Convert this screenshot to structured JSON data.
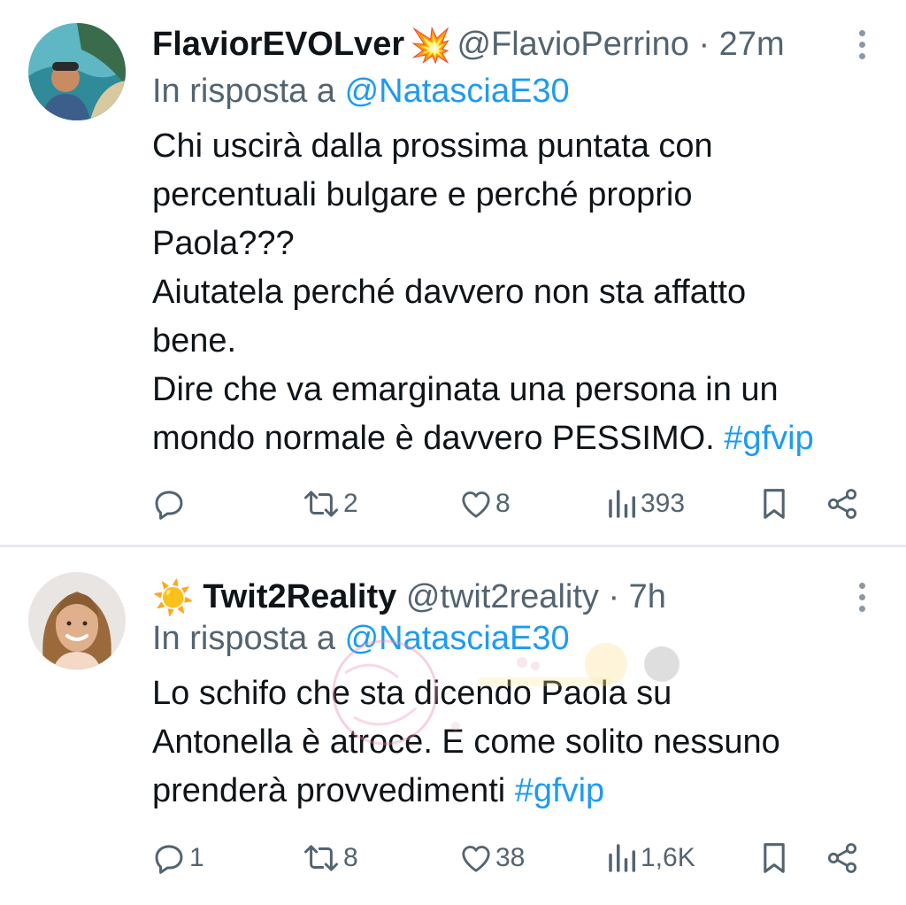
{
  "tweets": [
    {
      "display_name": "FlaviorEVOLver",
      "name_emoji": "💥",
      "handle": "@FlavioPerrino",
      "separator": "·",
      "time": "27m",
      "reply_prefix": "In risposta a",
      "reply_to": "@NatasciaE30",
      "body": "Chi uscirà dalla prossima puntata con\npercentuali bulgare e perché proprio\nPaola???\nAiutatela perché davvero non sta affatto\nbene.\nDire che va emarginata una persona in un\nmondo normale è davvero PESSIMO. ",
      "hashtag": "#gfvip",
      "replies": "",
      "retweets": "2",
      "likes": "8",
      "views": "393"
    },
    {
      "name_emoji": "☀️",
      "display_name": "Twit2Reality",
      "handle": "@twit2reality",
      "separator": "·",
      "time": "7h",
      "reply_prefix": "In risposta a",
      "reply_to": "@NatasciaE30",
      "body": "Lo schifo che sta dicendo Paola su\nAntonella è atroce. E come solito nessuno\nprenderà provvedimenti  ",
      "hashtag": "#gfvip",
      "replies": "1",
      "retweets": "8",
      "likes": "38",
      "views": "1,6K"
    }
  ],
  "icons": [
    "reply-icon",
    "retweet-icon",
    "like-icon",
    "views-icon",
    "bookmark-icon",
    "share-icon",
    "more-icon"
  ],
  "colors": {
    "link": "#1d9bf0",
    "muted": "#536471",
    "text": "#0f1419"
  }
}
